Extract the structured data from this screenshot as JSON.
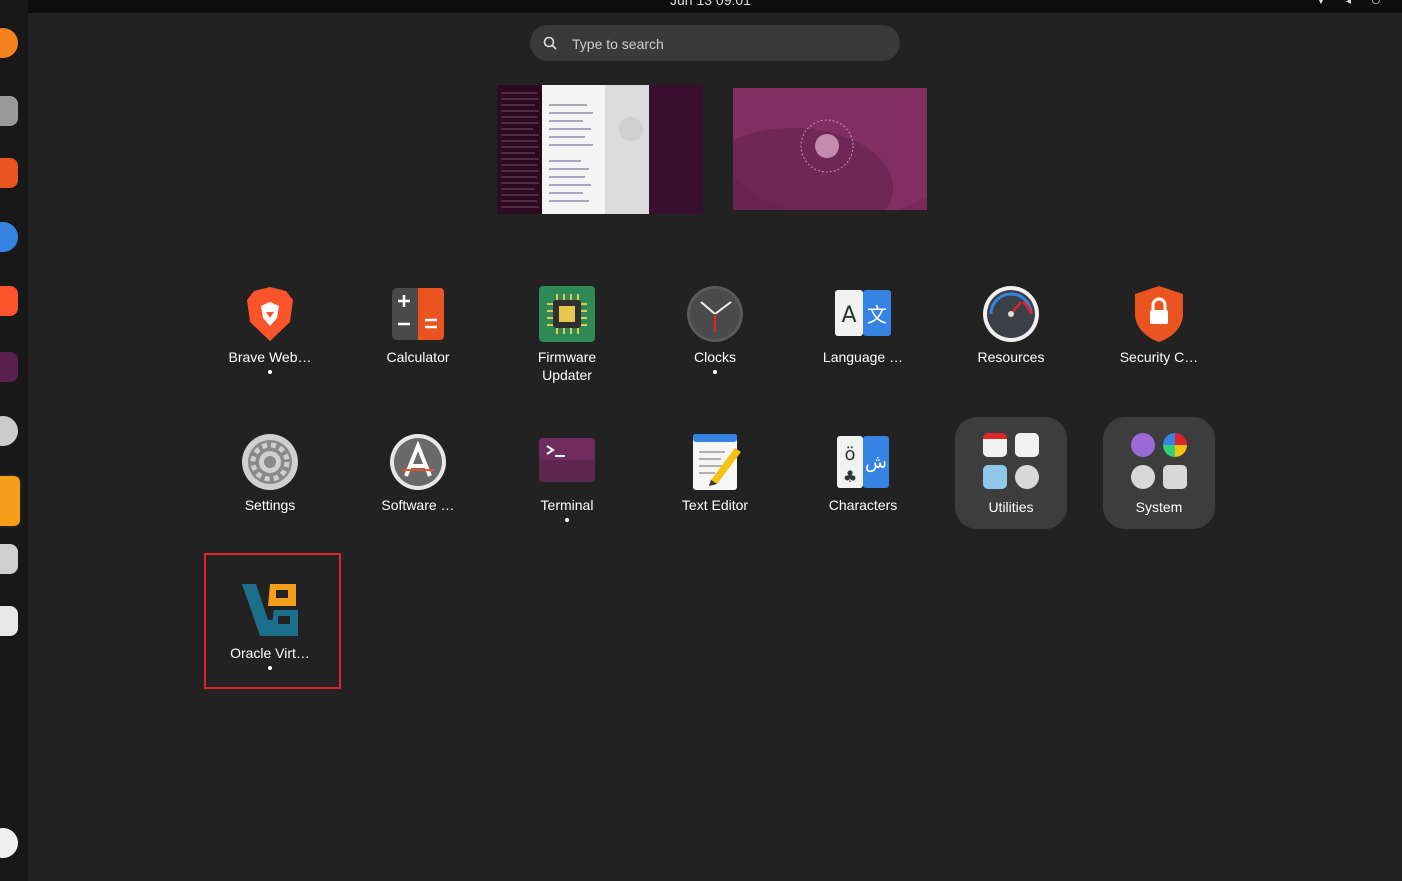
{
  "topbar": {
    "datetime": "Jun 13 09:01"
  },
  "search": {
    "placeholder": "Type to search"
  },
  "apps": [
    {
      "name": "Brave Web…",
      "icon": "brave-icon"
    },
    {
      "name": "Calculator",
      "icon": "calculator-icon"
    },
    {
      "name": "Firmware Updater",
      "icon": "firmware-icon"
    },
    {
      "name": "Clocks",
      "icon": "clock-icon"
    },
    {
      "name": "Language …",
      "icon": "language-icon"
    },
    {
      "name": "Resources",
      "icon": "gauge-icon"
    },
    {
      "name": "Security C…",
      "icon": "security-shield-icon"
    },
    {
      "name": "Settings",
      "icon": "gear-icon"
    },
    {
      "name": "Software …",
      "icon": "software-icon"
    },
    {
      "name": "Terminal",
      "icon": "terminal-icon"
    },
    {
      "name": "Text Editor",
      "icon": "text-editor-icon"
    },
    {
      "name": "Characters",
      "icon": "characters-icon"
    },
    {
      "name": "Utilities",
      "icon": "folder-icon"
    },
    {
      "name": "System",
      "icon": "folder-icon"
    },
    {
      "name": "Oracle Virt…",
      "icon": "virtualbox-icon"
    }
  ],
  "colors": {
    "highlight": "#e0242a",
    "background": "#222222",
    "folder": "#3d3d3d"
  }
}
